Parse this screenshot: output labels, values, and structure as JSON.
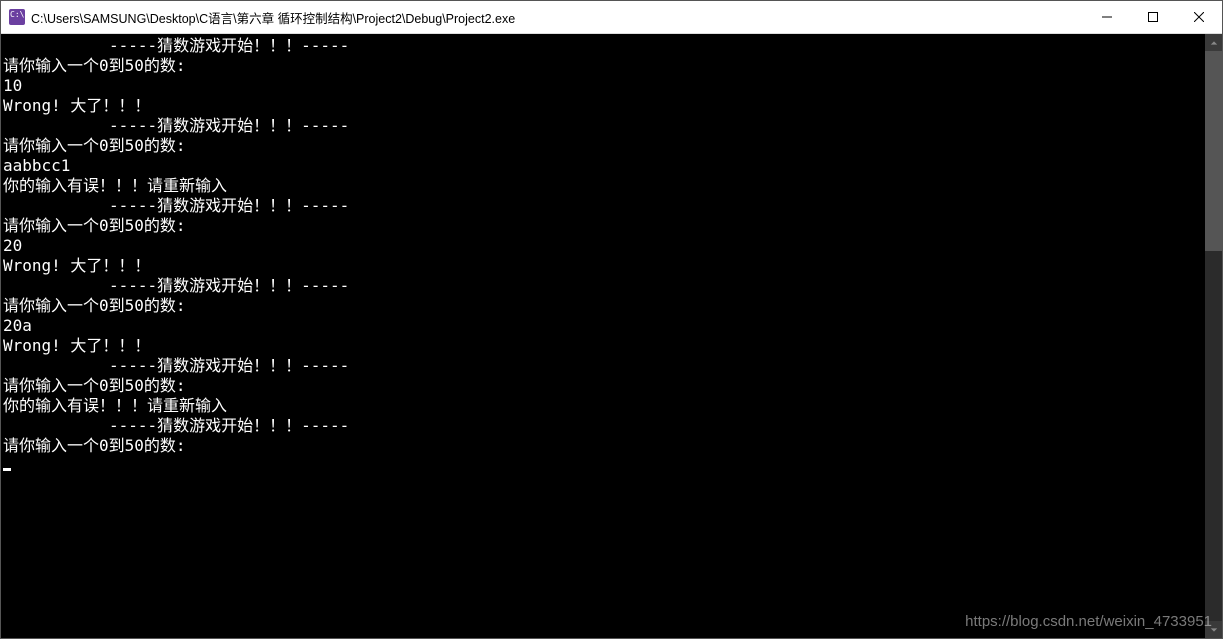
{
  "window": {
    "title": "C:\\Users\\SAMSUNG\\Desktop\\C语言\\第六章 循环控制结构\\Project2\\Debug\\Project2.exe"
  },
  "console": {
    "lines": [
      "           -----猜数游戏开始！！！-----",
      "请你输入一个0到50的数:",
      "10",
      "Wrong! 大了！！！",
      "           -----猜数游戏开始！！！-----",
      "请你输入一个0到50的数:",
      "aabbcc1",
      "你的输入有误！！！请重新输入",
      "           -----猜数游戏开始！！！-----",
      "请你输入一个0到50的数:",
      "20",
      "Wrong! 大了！！！",
      "           -----猜数游戏开始！！！-----",
      "请你输入一个0到50的数:",
      "20a",
      "Wrong! 大了！！！",
      "           -----猜数游戏开始！！！-----",
      "请你输入一个0到50的数:",
      "你的输入有误！！！请重新输入",
      "           -----猜数游戏开始！！！-----",
      "请你输入一个0到50的数:"
    ]
  },
  "watermark": "https://blog.csdn.net/weixin_4733951"
}
